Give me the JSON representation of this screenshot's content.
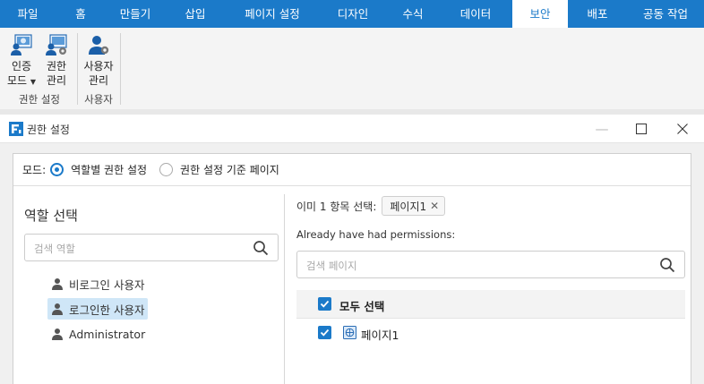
{
  "ribbon_tabs": [
    "파일",
    "홈",
    "만들기",
    "삽입",
    "페이지 설정",
    "디자인",
    "수식",
    "데이터",
    "보안",
    "배포",
    "공동 작업"
  ],
  "ribbon": {
    "auth_mode": {
      "line1": "인증",
      "line2": "모드"
    },
    "perm_manage": {
      "line1": "권한",
      "line2": "관리"
    },
    "group_perm": "권한 설정",
    "user_manage": {
      "line1": "사용자",
      "line2": "관리"
    },
    "group_user": "사용자"
  },
  "dialog": {
    "title": "권한 설정",
    "mode_label": "모드:",
    "mode_role": "역할별 권한 설정",
    "mode_page": "권한 설정 기준 페이지",
    "role_select_title": "역할 선택",
    "role_search_placeholder": "검색 역할",
    "roles": [
      "비로그인 사용자",
      "로그인한 사용자",
      "Administrator"
    ],
    "selected_prefix": "이미 1 항목 선택:",
    "selected_chip": "페이지1",
    "already_label": "Already have had permissions:",
    "page_search_placeholder": "검색 페이지",
    "select_all": "모두 선택",
    "page_item": "페이지1"
  },
  "colors": {
    "accent": "#1b7ac9",
    "selected_bg": "#cfe6f7"
  }
}
